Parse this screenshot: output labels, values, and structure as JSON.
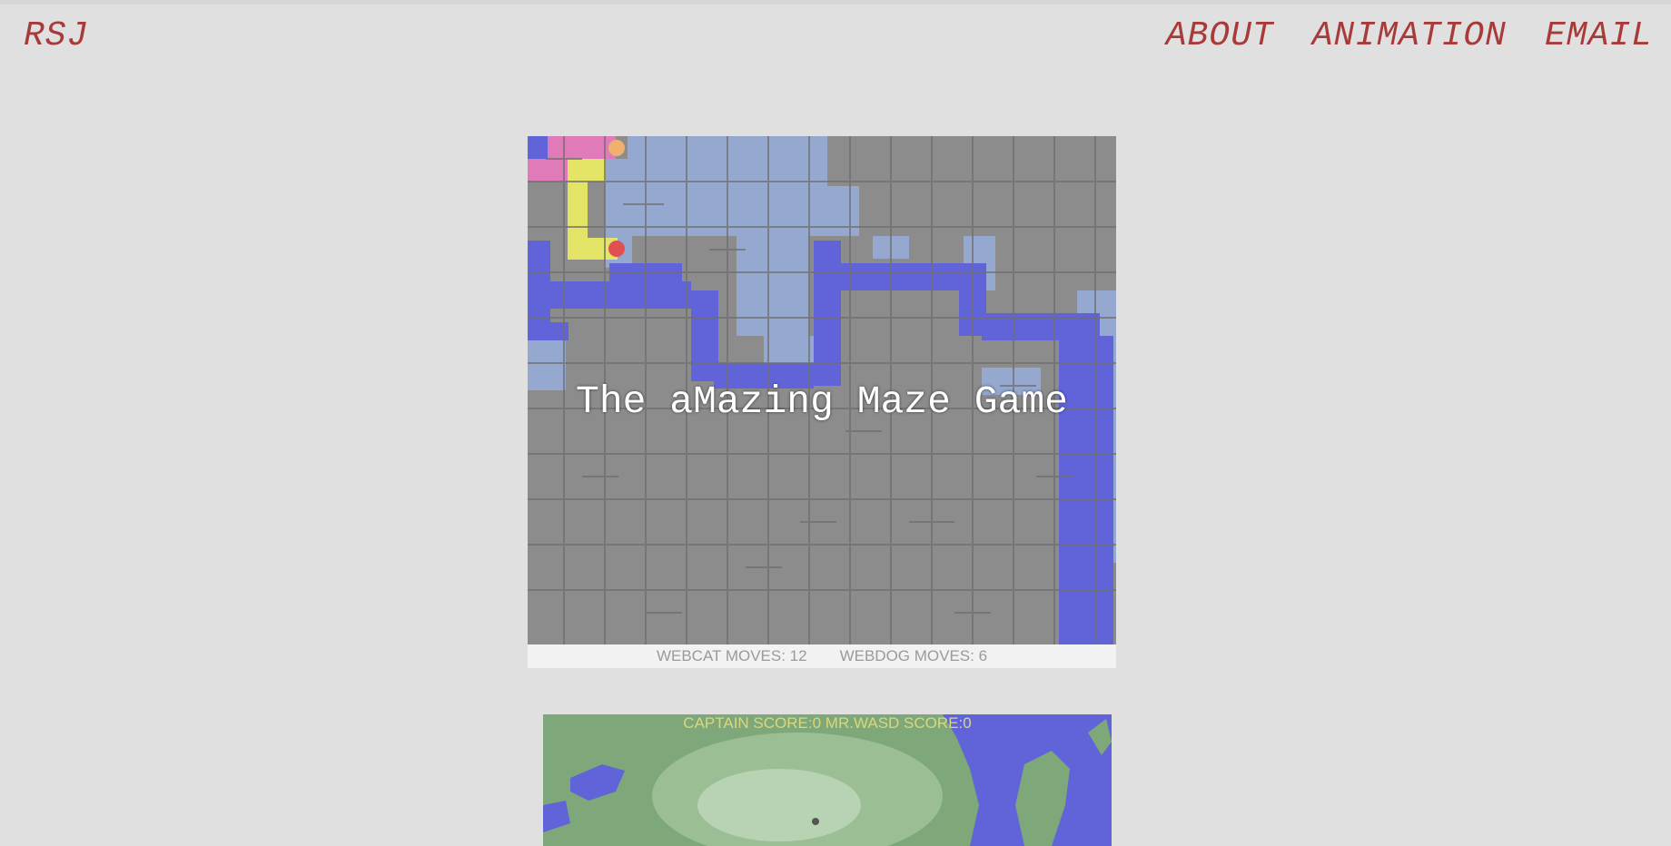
{
  "header": {
    "logo": "RSJ",
    "nav": [
      "ABOUT",
      "ANIMATION",
      "EMAIL"
    ]
  },
  "maze_card": {
    "title": "The aMazing Maze Game",
    "webcat_moves": "WEBCAT MOVES: 12",
    "webdog_moves": "WEBDOG MOVES: 6"
  },
  "island_card": {
    "score": "CAPTAIN SCORE:0  MR.WASD SCORE:0"
  },
  "colors": {
    "accent": "#a83a3a",
    "maze_wall": "#8c8c8c",
    "explored": "#94a8d0",
    "path": "#6064d8",
    "pink": "#e07ab8",
    "yellow": "#e4e466",
    "water": "#6064d8",
    "land": "#7ea87a"
  }
}
